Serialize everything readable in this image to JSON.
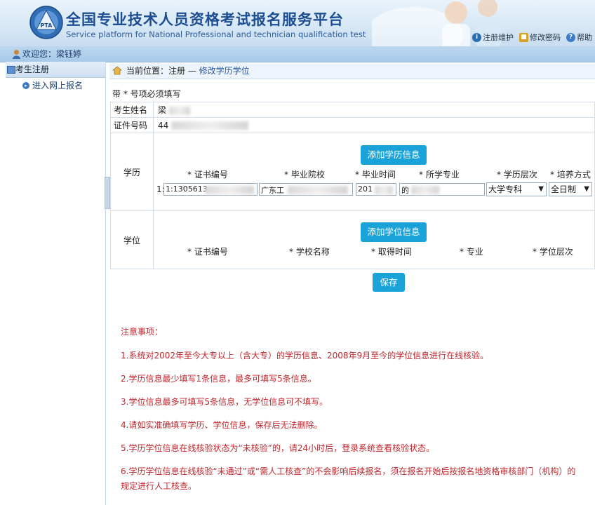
{
  "header": {
    "title_cn": "全国专业技术人员资格考试报名服务平台",
    "title_en": "Service platform for National Professional and technician qualification test",
    "logo_text": "PTA",
    "links": [
      {
        "label": "注册维护",
        "icon": "user-edit-icon"
      },
      {
        "label": "修改密码",
        "icon": "lock-icon"
      },
      {
        "label": "帮助",
        "icon": "help-icon"
      }
    ]
  },
  "welcome": {
    "text": "欢迎您：梁钰婷"
  },
  "sidebar": {
    "header": "考生注册",
    "items": [
      {
        "label": "进入网上报名"
      }
    ]
  },
  "breadcrumb": {
    "prefix": "当前位置：注册",
    "sep": " — ",
    "current": "修改学历学位"
  },
  "form": {
    "required_note": "带 * 号项必须填写",
    "name_label": "考生姓名",
    "name_value": "梁",
    "id_label": "证件号码",
    "id_value": "44",
    "education": {
      "label": "学历",
      "add_button": "添加学历信息",
      "columns": [
        "* 证书编号",
        "* 毕业院校",
        "* 毕业时间",
        "* 所学专业",
        "* 学历层次",
        "* 培养方式"
      ],
      "row": {
        "cert_no": "1:1305613",
        "school": "广东工",
        "grad_time": "201",
        "major": "的",
        "level": "大学专科",
        "mode": "全日制"
      }
    },
    "degree": {
      "label": "学位",
      "add_button": "添加学位信息",
      "columns": [
        "* 证书编号",
        "* 学校名称",
        "* 取得时间",
        "* 专业",
        "* 学位层次"
      ]
    },
    "save_button": "保存"
  },
  "notice": {
    "title": "注意事项：",
    "items": [
      "1.系统对2002年至今大专以上（含大专）的学历信息、2008年9月至今的学位信息进行在线核验。",
      "2.学历信息最少填写1条信息，最多可填写5条信息。",
      "3.学位信息最多可填写5条信息，无学位信息可不填写。",
      "4.请如实准确填写学历、学位信息，保存后无法删除。",
      "5.学历学位信息在线核验状态为“未核验”的，请24小时后，登录系统查看核验状态。",
      "6.学历学位信息在线核验“未通过”或“需人工核查”的不会影响后续报名，须在报名开始后按报名地资格审核部门（机构）的",
      "规定进行人工核查。"
    ]
  },
  "colors": {
    "accent": "#1aa3d9",
    "notice": "#c0262c",
    "title": "#1d4e93"
  }
}
